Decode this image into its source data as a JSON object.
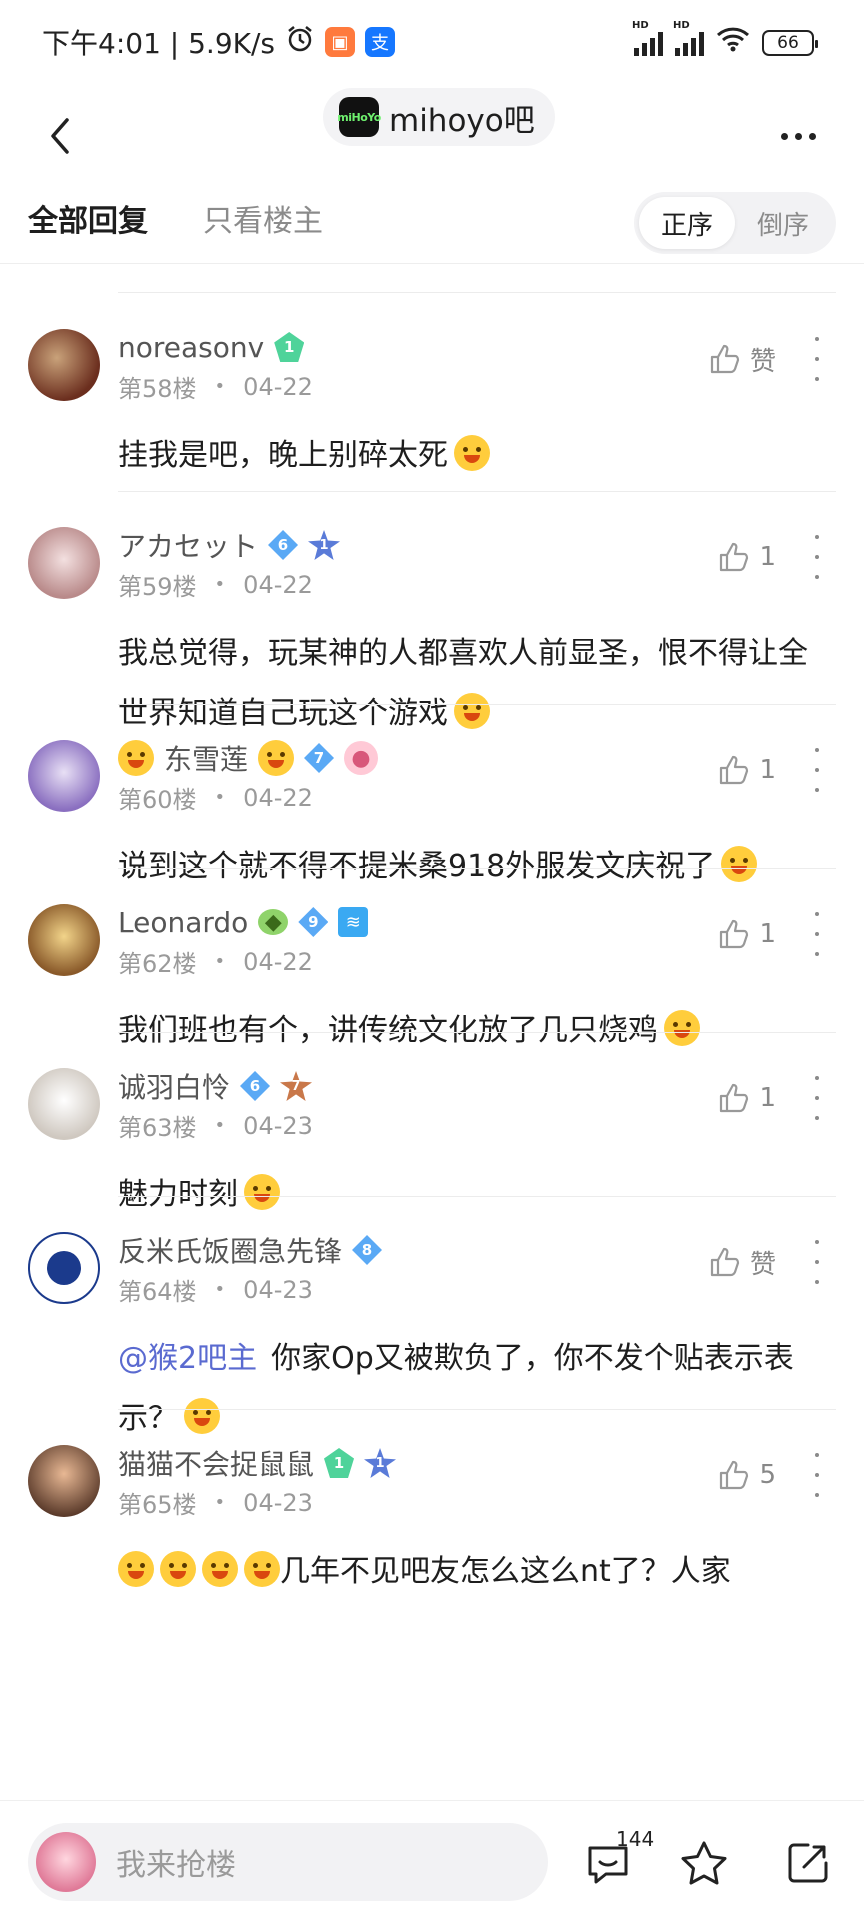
{
  "status_bar": {
    "time_speed": "下午4:01 | 5.9K/s",
    "signal1_label": "HD",
    "signal2_label": "HD",
    "battery": "66"
  },
  "nav": {
    "forum_logo_text": "miHoYo",
    "forum_name": "mihoyo吧"
  },
  "tabs": {
    "all_replies": "全部回复",
    "op_only": "只看楼主",
    "order_asc": "正序",
    "order_desc": "倒序"
  },
  "posts": [
    {
      "username": "noreasonv",
      "level": "1",
      "level_color": "#4fd39a",
      "floor": "第58楼",
      "date": "04-22",
      "like": "赞",
      "text": "挂我是吧，晚上别碎太死",
      "emoji": true
    },
    {
      "username": "アカセット",
      "level": "6",
      "level_color": "#5aa9f5",
      "extra_badge": "1",
      "floor": "第59楼",
      "date": "04-22",
      "like": "1",
      "text": "我总觉得，玩某神的人都喜欢人前显圣，恨不得让全世界知道自己玩这个游戏",
      "emoji": true
    },
    {
      "username_prefix_emoji": true,
      "username": "东雪莲",
      "level": "7",
      "level_color": "#5aa9f5",
      "floor": "第60楼",
      "date": "04-22",
      "like": "1",
      "text": "说到这个就不得不提米桑918外服发文庆祝了",
      "emoji": true
    },
    {
      "username": "Leonardo",
      "level": "9",
      "level_color": "#5aa9f5",
      "floor": "第62楼",
      "date": "04-22",
      "like": "1",
      "text": "我们班也有个，讲传统文化放了几只烧鸡",
      "emoji": true
    },
    {
      "username": "诚羽白怜",
      "level": "6",
      "level_color": "#5aa9f5",
      "extra_badge": "7",
      "floor": "第63楼",
      "date": "04-23",
      "like": "1",
      "text": "魅力时刻",
      "emoji": true
    },
    {
      "username": "反米氏饭圈急先锋",
      "level": "8",
      "level_color": "#5aa9f5",
      "floor": "第64楼",
      "date": "04-23",
      "like": "赞",
      "mention": "@猴2吧主",
      "text": "你家Op又被欺负了，你不发个贴表示表示？",
      "emoji": true
    },
    {
      "username": "猫猫不会捉鼠鼠",
      "level": "1",
      "level_color": "#4fd39a",
      "extra_badge": "1",
      "floor": "第65楼",
      "date": "04-23",
      "like": "5",
      "text": "几年不见吧友怎么这么nt了？人家",
      "emoji_prefix": true
    }
  ],
  "bottom": {
    "placeholder": "我来抢楼",
    "reply_count": "144"
  }
}
